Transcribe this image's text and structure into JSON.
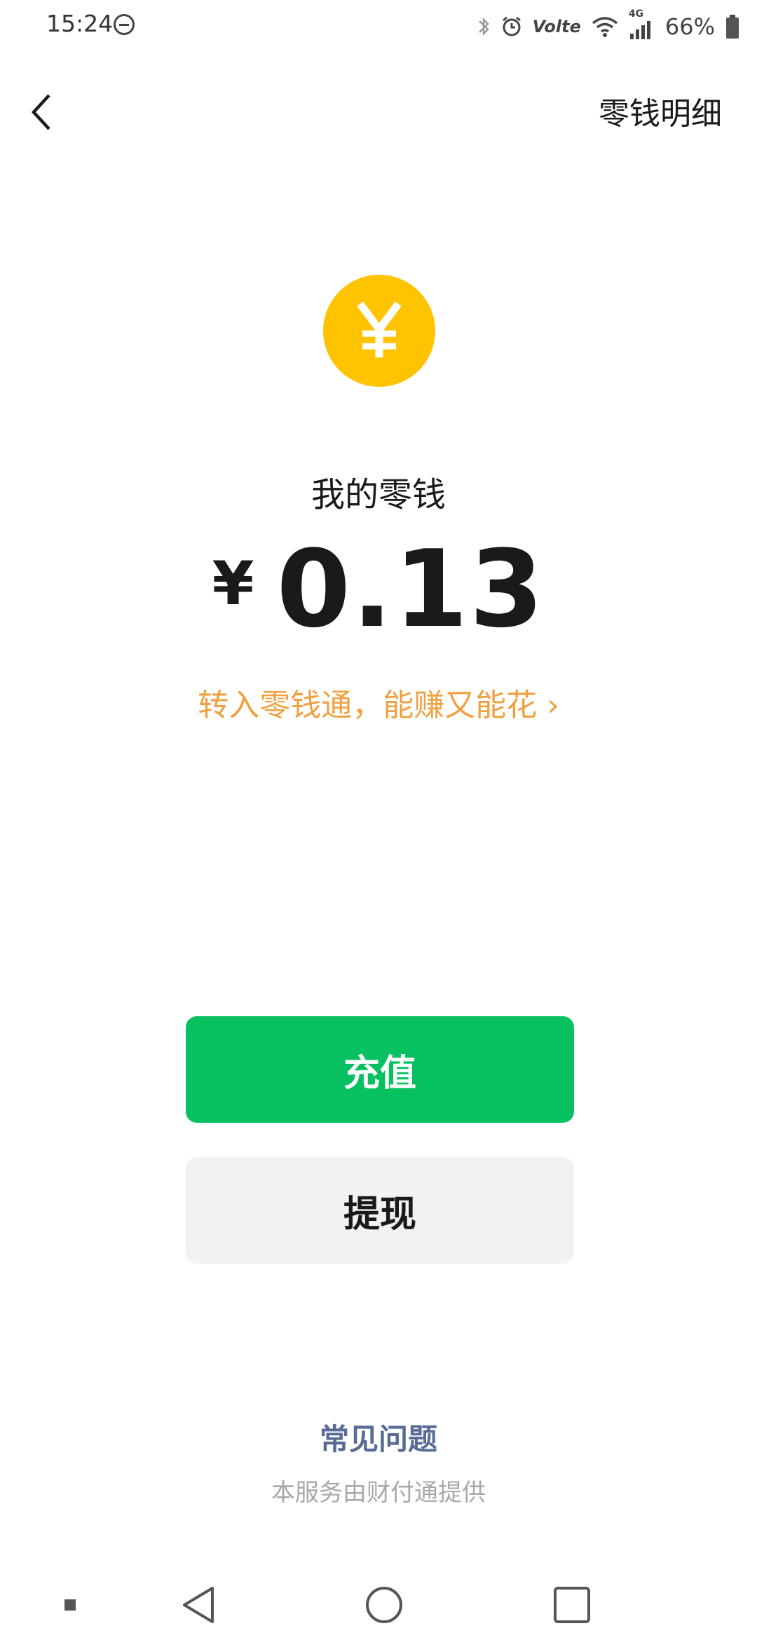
{
  "status_bar": {
    "time": "15:24",
    "network": "4G",
    "volte": "Volte",
    "battery": "66%"
  },
  "app_bar": {
    "action_label": "零钱明细"
  },
  "balance": {
    "label": "我的零钱",
    "currency": "¥",
    "amount": "0.13"
  },
  "promo": {
    "text": "转入零钱通，能赚又能花 ›"
  },
  "buttons": {
    "recharge": "充值",
    "withdraw": "提现"
  },
  "footer": {
    "faq": "常见问题",
    "provider": "本服务由财付通提供"
  },
  "colors": {
    "brand_green": "#07C160",
    "coin_yellow": "#FFC300",
    "promo_orange": "#F0A040",
    "link_blue": "#576B95"
  },
  "icons": [
    "bluetooth-icon",
    "alarm-icon",
    "wifi-icon",
    "signal-icon",
    "battery-icon",
    "back-icon",
    "yuan-icon",
    "nav-back-icon",
    "nav-home-icon",
    "nav-recents-icon",
    "nav-menu-icon"
  ]
}
